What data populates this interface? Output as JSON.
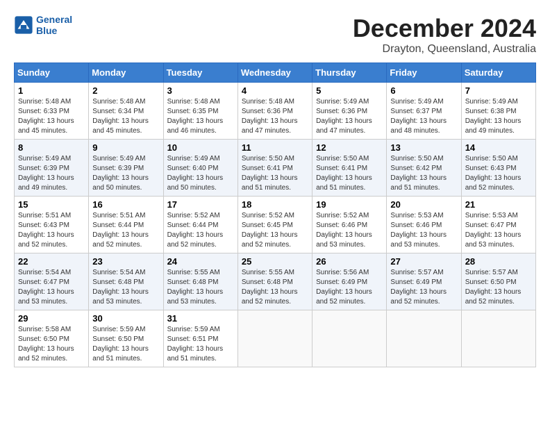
{
  "header": {
    "logo_line1": "General",
    "logo_line2": "Blue",
    "title": "December 2024",
    "subtitle": "Drayton, Queensland, Australia"
  },
  "weekdays": [
    "Sunday",
    "Monday",
    "Tuesday",
    "Wednesday",
    "Thursday",
    "Friday",
    "Saturday"
  ],
  "weeks": [
    [
      {
        "day": "1",
        "sunrise": "5:48 AM",
        "sunset": "6:33 PM",
        "daylight": "Daylight: 13 hours and 45 minutes."
      },
      {
        "day": "2",
        "sunrise": "5:48 AM",
        "sunset": "6:34 PM",
        "daylight": "Daylight: 13 hours and 45 minutes."
      },
      {
        "day": "3",
        "sunrise": "5:48 AM",
        "sunset": "6:35 PM",
        "daylight": "Daylight: 13 hours and 46 minutes."
      },
      {
        "day": "4",
        "sunrise": "5:48 AM",
        "sunset": "6:36 PM",
        "daylight": "Daylight: 13 hours and 47 minutes."
      },
      {
        "day": "5",
        "sunrise": "5:49 AM",
        "sunset": "6:36 PM",
        "daylight": "Daylight: 13 hours and 47 minutes."
      },
      {
        "day": "6",
        "sunrise": "5:49 AM",
        "sunset": "6:37 PM",
        "daylight": "Daylight: 13 hours and 48 minutes."
      },
      {
        "day": "7",
        "sunrise": "5:49 AM",
        "sunset": "6:38 PM",
        "daylight": "Daylight: 13 hours and 49 minutes."
      }
    ],
    [
      {
        "day": "8",
        "sunrise": "5:49 AM",
        "sunset": "6:39 PM",
        "daylight": "Daylight: 13 hours and 49 minutes."
      },
      {
        "day": "9",
        "sunrise": "5:49 AM",
        "sunset": "6:39 PM",
        "daylight": "Daylight: 13 hours and 50 minutes."
      },
      {
        "day": "10",
        "sunrise": "5:49 AM",
        "sunset": "6:40 PM",
        "daylight": "Daylight: 13 hours and 50 minutes."
      },
      {
        "day": "11",
        "sunrise": "5:50 AM",
        "sunset": "6:41 PM",
        "daylight": "Daylight: 13 hours and 51 minutes."
      },
      {
        "day": "12",
        "sunrise": "5:50 AM",
        "sunset": "6:41 PM",
        "daylight": "Daylight: 13 hours and 51 minutes."
      },
      {
        "day": "13",
        "sunrise": "5:50 AM",
        "sunset": "6:42 PM",
        "daylight": "Daylight: 13 hours and 51 minutes."
      },
      {
        "day": "14",
        "sunrise": "5:50 AM",
        "sunset": "6:43 PM",
        "daylight": "Daylight: 13 hours and 52 minutes."
      }
    ],
    [
      {
        "day": "15",
        "sunrise": "5:51 AM",
        "sunset": "6:43 PM",
        "daylight": "Daylight: 13 hours and 52 minutes."
      },
      {
        "day": "16",
        "sunrise": "5:51 AM",
        "sunset": "6:44 PM",
        "daylight": "Daylight: 13 hours and 52 minutes."
      },
      {
        "day": "17",
        "sunrise": "5:52 AM",
        "sunset": "6:44 PM",
        "daylight": "Daylight: 13 hours and 52 minutes."
      },
      {
        "day": "18",
        "sunrise": "5:52 AM",
        "sunset": "6:45 PM",
        "daylight": "Daylight: 13 hours and 52 minutes."
      },
      {
        "day": "19",
        "sunrise": "5:52 AM",
        "sunset": "6:46 PM",
        "daylight": "Daylight: 13 hours and 53 minutes."
      },
      {
        "day": "20",
        "sunrise": "5:53 AM",
        "sunset": "6:46 PM",
        "daylight": "Daylight: 13 hours and 53 minutes."
      },
      {
        "day": "21",
        "sunrise": "5:53 AM",
        "sunset": "6:47 PM",
        "daylight": "Daylight: 13 hours and 53 minutes."
      }
    ],
    [
      {
        "day": "22",
        "sunrise": "5:54 AM",
        "sunset": "6:47 PM",
        "daylight": "Daylight: 13 hours and 53 minutes."
      },
      {
        "day": "23",
        "sunrise": "5:54 AM",
        "sunset": "6:48 PM",
        "daylight": "Daylight: 13 hours and 53 minutes."
      },
      {
        "day": "24",
        "sunrise": "5:55 AM",
        "sunset": "6:48 PM",
        "daylight": "Daylight: 13 hours and 53 minutes."
      },
      {
        "day": "25",
        "sunrise": "5:55 AM",
        "sunset": "6:48 PM",
        "daylight": "Daylight: 13 hours and 52 minutes."
      },
      {
        "day": "26",
        "sunrise": "5:56 AM",
        "sunset": "6:49 PM",
        "daylight": "Daylight: 13 hours and 52 minutes."
      },
      {
        "day": "27",
        "sunrise": "5:57 AM",
        "sunset": "6:49 PM",
        "daylight": "Daylight: 13 hours and 52 minutes."
      },
      {
        "day": "28",
        "sunrise": "5:57 AM",
        "sunset": "6:50 PM",
        "daylight": "Daylight: 13 hours and 52 minutes."
      }
    ],
    [
      {
        "day": "29",
        "sunrise": "5:58 AM",
        "sunset": "6:50 PM",
        "daylight": "Daylight: 13 hours and 52 minutes."
      },
      {
        "day": "30",
        "sunrise": "5:59 AM",
        "sunset": "6:50 PM",
        "daylight": "Daylight: 13 hours and 51 minutes."
      },
      {
        "day": "31",
        "sunrise": "5:59 AM",
        "sunset": "6:51 PM",
        "daylight": "Daylight: 13 hours and 51 minutes."
      },
      null,
      null,
      null,
      null
    ]
  ]
}
